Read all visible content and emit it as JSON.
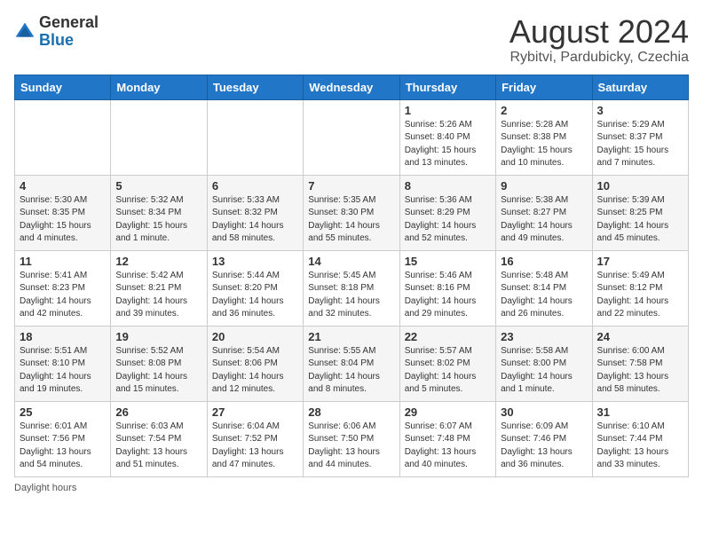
{
  "logo": {
    "general": "General",
    "blue": "Blue"
  },
  "header": {
    "month": "August 2024",
    "location": "Rybitvi, Pardubicky, Czechia"
  },
  "days_of_week": [
    "Sunday",
    "Monday",
    "Tuesday",
    "Wednesday",
    "Thursday",
    "Friday",
    "Saturday"
  ],
  "footer": {
    "note": "Daylight hours"
  },
  "weeks": [
    [
      {
        "day": "",
        "info": ""
      },
      {
        "day": "",
        "info": ""
      },
      {
        "day": "",
        "info": ""
      },
      {
        "day": "",
        "info": ""
      },
      {
        "day": "1",
        "info": "Sunrise: 5:26 AM\nSunset: 8:40 PM\nDaylight: 15 hours\nand 13 minutes."
      },
      {
        "day": "2",
        "info": "Sunrise: 5:28 AM\nSunset: 8:38 PM\nDaylight: 15 hours\nand 10 minutes."
      },
      {
        "day": "3",
        "info": "Sunrise: 5:29 AM\nSunset: 8:37 PM\nDaylight: 15 hours\nand 7 minutes."
      }
    ],
    [
      {
        "day": "4",
        "info": "Sunrise: 5:30 AM\nSunset: 8:35 PM\nDaylight: 15 hours\nand 4 minutes."
      },
      {
        "day": "5",
        "info": "Sunrise: 5:32 AM\nSunset: 8:34 PM\nDaylight: 15 hours\nand 1 minute."
      },
      {
        "day": "6",
        "info": "Sunrise: 5:33 AM\nSunset: 8:32 PM\nDaylight: 14 hours\nand 58 minutes."
      },
      {
        "day": "7",
        "info": "Sunrise: 5:35 AM\nSunset: 8:30 PM\nDaylight: 14 hours\nand 55 minutes."
      },
      {
        "day": "8",
        "info": "Sunrise: 5:36 AM\nSunset: 8:29 PM\nDaylight: 14 hours\nand 52 minutes."
      },
      {
        "day": "9",
        "info": "Sunrise: 5:38 AM\nSunset: 8:27 PM\nDaylight: 14 hours\nand 49 minutes."
      },
      {
        "day": "10",
        "info": "Sunrise: 5:39 AM\nSunset: 8:25 PM\nDaylight: 14 hours\nand 45 minutes."
      }
    ],
    [
      {
        "day": "11",
        "info": "Sunrise: 5:41 AM\nSunset: 8:23 PM\nDaylight: 14 hours\nand 42 minutes."
      },
      {
        "day": "12",
        "info": "Sunrise: 5:42 AM\nSunset: 8:21 PM\nDaylight: 14 hours\nand 39 minutes."
      },
      {
        "day": "13",
        "info": "Sunrise: 5:44 AM\nSunset: 8:20 PM\nDaylight: 14 hours\nand 36 minutes."
      },
      {
        "day": "14",
        "info": "Sunrise: 5:45 AM\nSunset: 8:18 PM\nDaylight: 14 hours\nand 32 minutes."
      },
      {
        "day": "15",
        "info": "Sunrise: 5:46 AM\nSunset: 8:16 PM\nDaylight: 14 hours\nand 29 minutes."
      },
      {
        "day": "16",
        "info": "Sunrise: 5:48 AM\nSunset: 8:14 PM\nDaylight: 14 hours\nand 26 minutes."
      },
      {
        "day": "17",
        "info": "Sunrise: 5:49 AM\nSunset: 8:12 PM\nDaylight: 14 hours\nand 22 minutes."
      }
    ],
    [
      {
        "day": "18",
        "info": "Sunrise: 5:51 AM\nSunset: 8:10 PM\nDaylight: 14 hours\nand 19 minutes."
      },
      {
        "day": "19",
        "info": "Sunrise: 5:52 AM\nSunset: 8:08 PM\nDaylight: 14 hours\nand 15 minutes."
      },
      {
        "day": "20",
        "info": "Sunrise: 5:54 AM\nSunset: 8:06 PM\nDaylight: 14 hours\nand 12 minutes."
      },
      {
        "day": "21",
        "info": "Sunrise: 5:55 AM\nSunset: 8:04 PM\nDaylight: 14 hours\nand 8 minutes."
      },
      {
        "day": "22",
        "info": "Sunrise: 5:57 AM\nSunset: 8:02 PM\nDaylight: 14 hours\nand 5 minutes."
      },
      {
        "day": "23",
        "info": "Sunrise: 5:58 AM\nSunset: 8:00 PM\nDaylight: 14 hours\nand 1 minute."
      },
      {
        "day": "24",
        "info": "Sunrise: 6:00 AM\nSunset: 7:58 PM\nDaylight: 13 hours\nand 58 minutes."
      }
    ],
    [
      {
        "day": "25",
        "info": "Sunrise: 6:01 AM\nSunset: 7:56 PM\nDaylight: 13 hours\nand 54 minutes."
      },
      {
        "day": "26",
        "info": "Sunrise: 6:03 AM\nSunset: 7:54 PM\nDaylight: 13 hours\nand 51 minutes."
      },
      {
        "day": "27",
        "info": "Sunrise: 6:04 AM\nSunset: 7:52 PM\nDaylight: 13 hours\nand 47 minutes."
      },
      {
        "day": "28",
        "info": "Sunrise: 6:06 AM\nSunset: 7:50 PM\nDaylight: 13 hours\nand 44 minutes."
      },
      {
        "day": "29",
        "info": "Sunrise: 6:07 AM\nSunset: 7:48 PM\nDaylight: 13 hours\nand 40 minutes."
      },
      {
        "day": "30",
        "info": "Sunrise: 6:09 AM\nSunset: 7:46 PM\nDaylight: 13 hours\nand 36 minutes."
      },
      {
        "day": "31",
        "info": "Sunrise: 6:10 AM\nSunset: 7:44 PM\nDaylight: 13 hours\nand 33 minutes."
      }
    ]
  ]
}
